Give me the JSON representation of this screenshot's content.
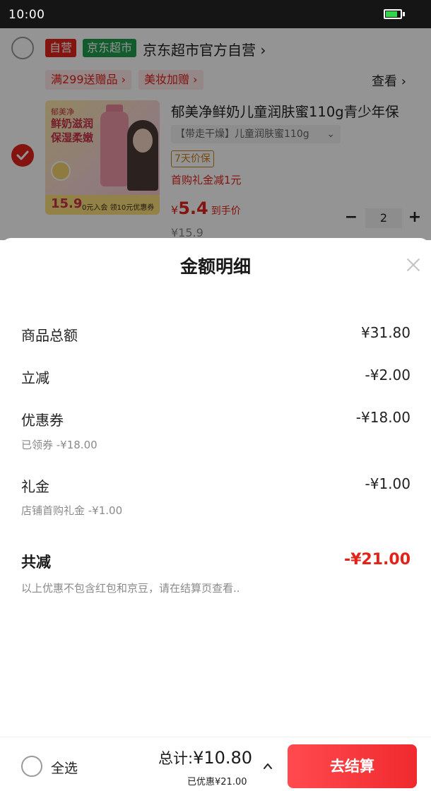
{
  "status_bar": {
    "time": "10:00",
    "battery_level": 0.8
  },
  "store": {
    "tag_self": "自营",
    "tag_market": "京东超市",
    "name": "京东超市官方自营 ›",
    "promos": [
      "满299送赠品 ›",
      "美妆加赠 ›"
    ],
    "view_link": "查看 ›"
  },
  "product": {
    "title": "郁美净鲜奶儿童润肤蜜110g青少年保",
    "image_texts": {
      "brand": "郁美净",
      "line1": "鲜奶滋润",
      "line2": "保湿柔嫩",
      "bottom_price": "15.9",
      "bottom_text": "0元入会 领10元优惠券"
    },
    "spec": "【带走干燥】儿童润肤蜜110g",
    "spec_arrow": "⌄",
    "badge": "7天价保",
    "first_buy": "首购礼金减1元",
    "price_currency": "¥",
    "price_value": "5.4",
    "price_suffix": "到手价",
    "original_price": "¥15.9",
    "quantity": "2",
    "qty_minus": "−",
    "qty_plus": "+"
  },
  "sheet": {
    "title": "金额明细",
    "rows": [
      {
        "label": "商品总额",
        "value": "¥31.80"
      },
      {
        "label": "立减",
        "value": "-¥2.00"
      },
      {
        "label": "优惠券",
        "value": "-¥18.00",
        "sub": "已领券 -¥18.00"
      },
      {
        "label": "礼金",
        "value": "-¥1.00",
        "sub": "店铺首购礼金 -¥1.00"
      }
    ],
    "total_label": "共减",
    "total_value": "-¥21.00",
    "note": "以上优惠不包含红包和京豆，请在结算页查看.."
  },
  "bottom_bar": {
    "select_all": "全选",
    "total_label": "总计:",
    "total_amount": "¥10.80",
    "saved": "已优惠¥21.00",
    "checkout": "去结算"
  },
  "colors": {
    "accent": "#e2231a",
    "market_green": "#1e9e4f",
    "checkout": "#f0292e"
  }
}
